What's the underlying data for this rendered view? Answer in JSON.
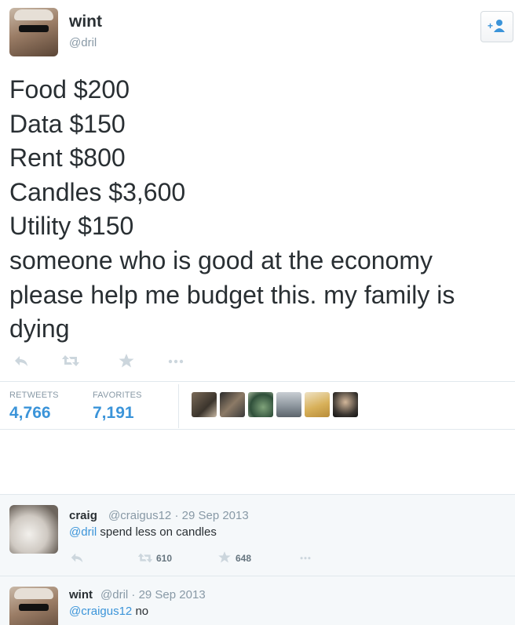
{
  "tweet": {
    "display_name": "wint",
    "handle": "@dril",
    "lines": [
      "Food $200",
      "Data $150",
      "Rent $800",
      "Candles $3,600",
      "Utility $150",
      "someone who is good at the economy",
      "please help me budget this. my family is",
      "dying"
    ],
    "action_icons": [
      "reply-icon",
      "retweet-icon",
      "favorite-icon",
      "more-icon"
    ],
    "stats": {
      "retweets_label": "RETWEETS",
      "retweets_value": "4,766",
      "favorites_label": "FAVORITES",
      "favorites_value": "7,191"
    }
  },
  "replies": [
    {
      "display_name": "craig",
      "handle": "@craigus12",
      "separator": "·",
      "date": "29 Sep 2013",
      "mention": "@dril",
      "text": " spend less on candles",
      "retweet_count": "610",
      "favorite_count": "648"
    },
    {
      "display_name": "wint",
      "handle": "@dril",
      "separator": "·",
      "date": "29 Sep 2013",
      "mention": "@craigus12",
      "text": " no"
    }
  ],
  "colors": {
    "link": "#3b94d9",
    "muted": "#8899a6",
    "text": "#292f33",
    "divider": "#e1e8ed",
    "reply_bg": "#f5f8fa"
  }
}
